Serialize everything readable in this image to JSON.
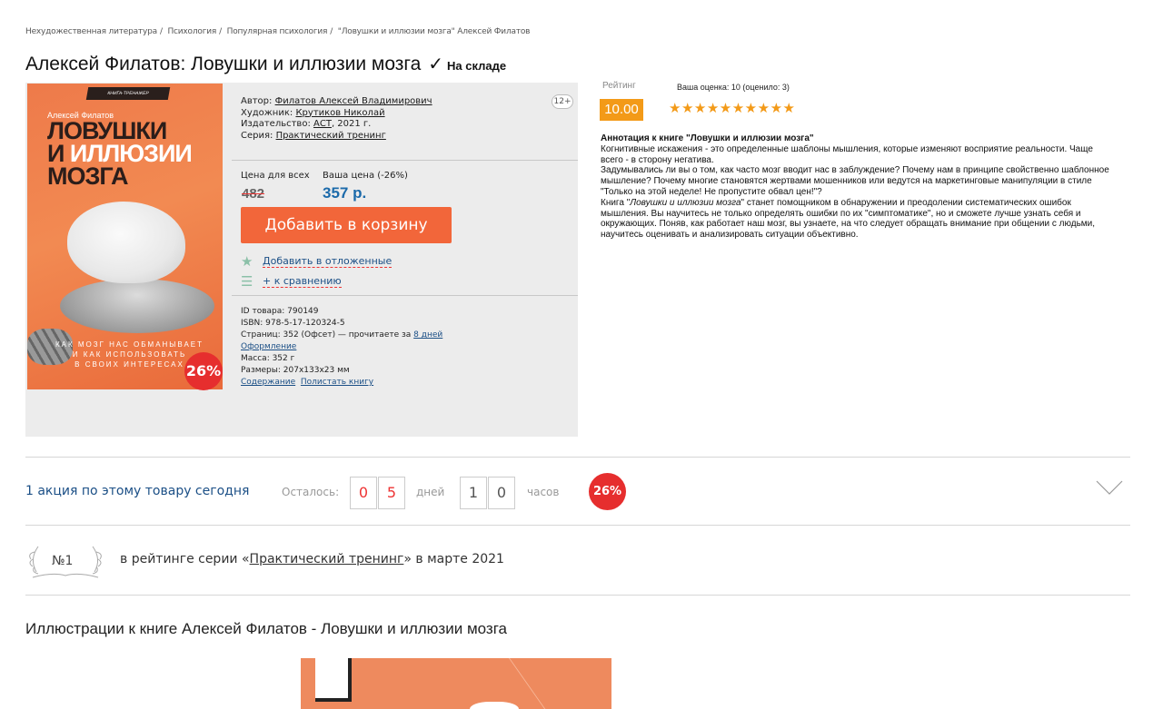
{
  "breadcrumbs": [
    "Нехудожественная литература",
    "Психология",
    "Популярная психология",
    "\"Ловушки и иллюзии мозга\" Алексей Филатов"
  ],
  "title": "Алексей Филатов: Ловушки и иллюзии мозга",
  "stock": "На складе",
  "cover": {
    "series_label": "КНИГА-ТРЕНАЖЕР",
    "author": "Алексей Филатов",
    "title_l1": "ЛОВУШКИ",
    "title_l2a": "И ",
    "title_l2b": "ИЛЛЮЗИИ",
    "title_l3": "МОЗГА",
    "bottom_l1": "КАК МОЗГ НАС ОБМАНЫВАЕТ",
    "bottom_l2": "И КАК ИСПОЛЬЗОВАТЬ",
    "bottom_l3": "В СВОИХ ИНТЕРЕСАХ"
  },
  "discount_badge": "26%",
  "age": "12+",
  "info": {
    "author_label": "Автор:",
    "author": "Филатов Алексей Владимирович",
    "artist_label": "Художник:",
    "artist": "Крутиков Николай",
    "publisher_label": "Издательство:",
    "publisher": "АСТ",
    "year": ", 2021 г.",
    "series_label": "Серия:",
    "series": "Практический тренинг"
  },
  "price": {
    "all_label": "Цена для всех",
    "your_label": "Ваша цена (-26%)",
    "old": "482",
    "new": "357 р.",
    "cart_button": "Добавить в корзину",
    "wishlist": "Добавить в отложенные",
    "compare": "+ к сравнению"
  },
  "details": {
    "id": "ID товара: 790149",
    "isbn": "ISBN: 978-5-17-120324-5",
    "pages": "Страниц: 352 (Офсет) — прочитаете за ",
    "read_time": "8 дней",
    "design": "Оформление",
    "mass": "Масса: 352 г",
    "size": "Размеры: 207x133x23 мм",
    "contents": "Содержание",
    "browse": "Полистать книгу"
  },
  "rating": {
    "label": "Рейтинг",
    "value": "10.00",
    "your": "Ваша оценка: 10 (оценило: 3)",
    "stars": "★★★★★★★★★★"
  },
  "annotation": {
    "heading": "Аннотация к книге \"Ловушки и иллюзии мозга\"",
    "p1": "Когнитивные искажения - это определенные шаблоны мышления, которые изменяют восприятие реальности. Чаще всего - в сторону негатива.",
    "p2": "Задумывались ли вы о том, как часто мозг вводит нас в заблуждение? Почему нам в принципе свойственно шаблонное мышление? Почему многие становятся жертвами мошенников или ведутся на маркетинговые манипуляции в стиле \"Только на этой неделе! Не пропустите обвал цен!\"?",
    "p3a": "Книга \"",
    "p3i": "Ловушки и иллюзии мозга",
    "p3b": "\" станет помощником в обнаружении и преодолении систематических ошибок мышления. Вы научитесь не только определять ошибки по их \"симптоматике\", но и сможете лучше узнать себя и окружающих. Поняв, как работает наш мозг, вы узнаете, на что следует обращать внимание при общении с людьми, научитесь оценивать и анализировать ситуации объективно."
  },
  "promo": {
    "text": "1 акция по этому товару сегодня",
    "remain_label": "Осталось:",
    "days": [
      "0",
      "5"
    ],
    "days_label": "дней",
    "hours": [
      "1",
      "0"
    ],
    "hours_label": "часов",
    "badge": "26%"
  },
  "rank": {
    "number": "№1",
    "text_before": "в рейтинге серии «",
    "series": "Практический тренинг",
    "text_after": "» в марте 2021"
  },
  "illustrations_title": "Иллюстрации к книге Алексей Филатов - Ловушки и иллюзии мозга",
  "colors": {
    "accent_orange": "#f2663a",
    "link_blue": "#1b4f86",
    "price_blue": "#1b6aaa",
    "rating_orange": "#f39a18",
    "badge_red": "#e62e2e"
  }
}
